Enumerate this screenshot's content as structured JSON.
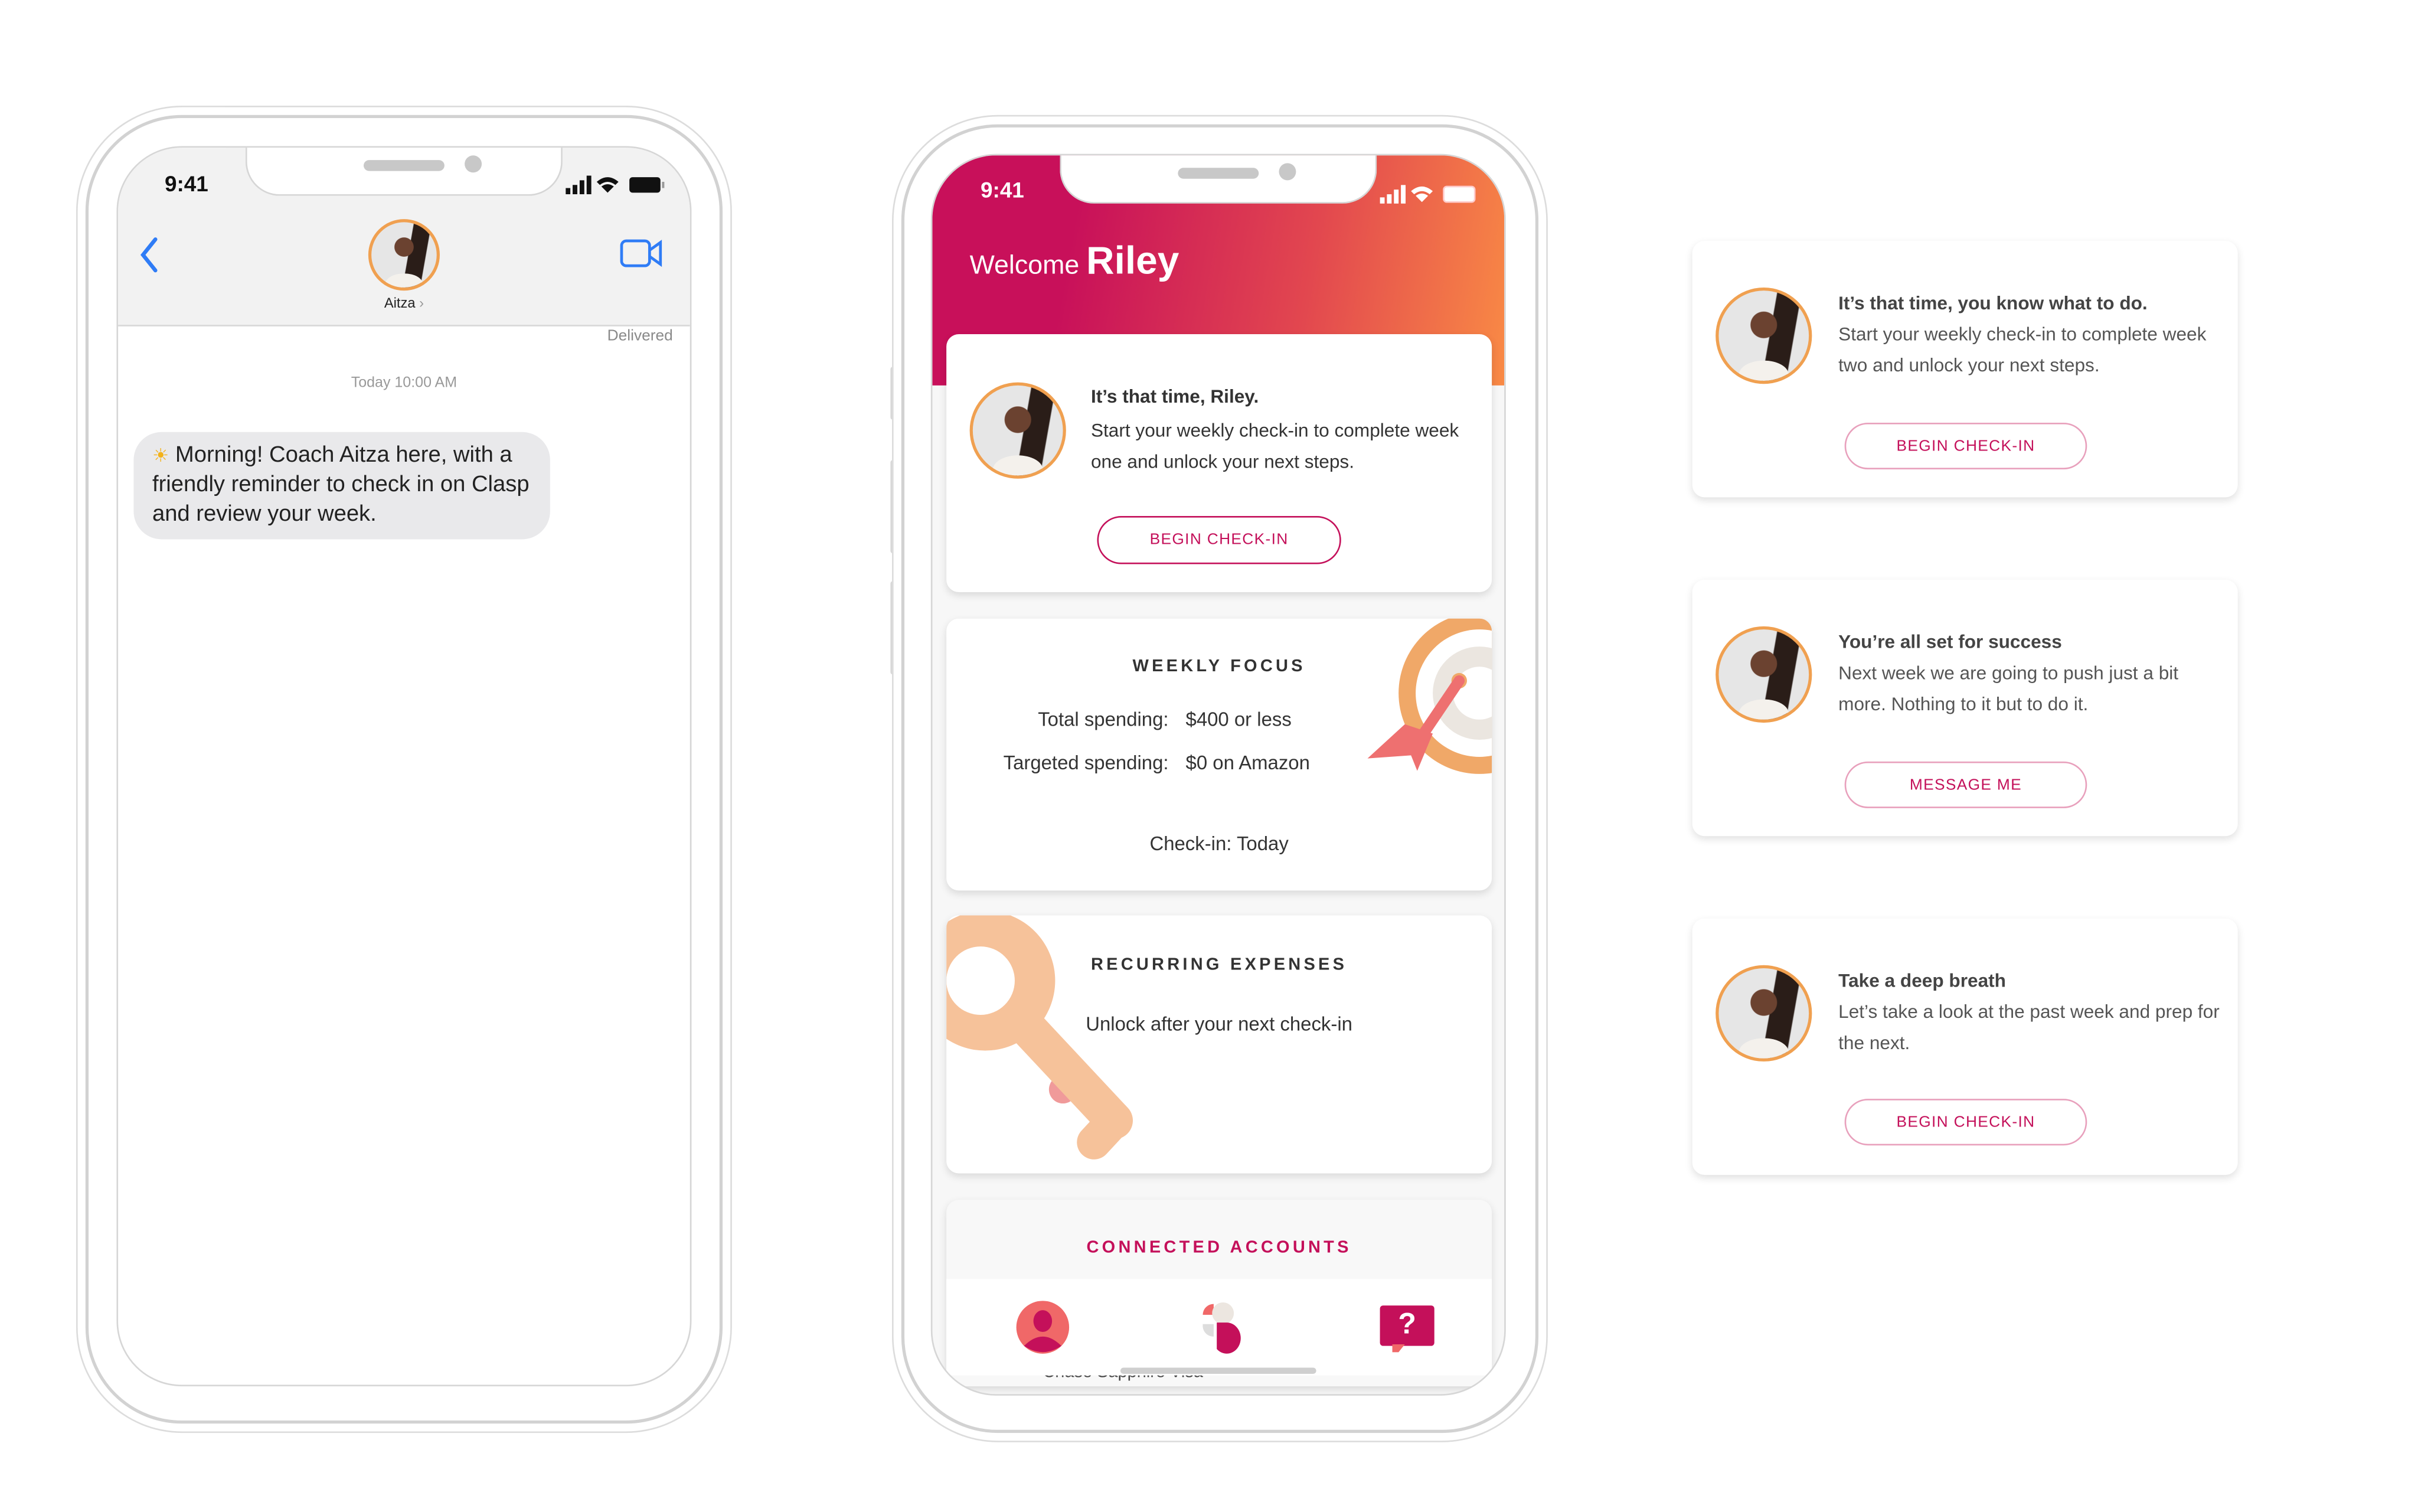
{
  "messages_phone": {
    "status_time": "9:41",
    "contact_name": "Aitza",
    "contact_chevron": "›",
    "delivered": "Delivered",
    "timestamp": "Today 10:00 AM",
    "message_emoji": "☀",
    "message_text": "Morning! Coach Aitza here, with a friendly reminder to check in on Clasp and review your week.",
    "icons": {
      "back": "chevron-left-icon",
      "video": "video-camera-icon"
    },
    "accent": "#2f7cf6"
  },
  "app_phone": {
    "status_time": "9:41",
    "welcome": "Welcome",
    "user_name": "Riley",
    "checkin_card": {
      "title": "It’s that time, Riley.",
      "body": "Start your weekly check-in to complete week one and unlock your next steps.",
      "button": "BEGIN CHECK-IN"
    },
    "weekly_focus": {
      "heading": "WEEKLY FOCUS",
      "rows": [
        {
          "label": "Total spending:",
          "value": "$400 or less"
        },
        {
          "label": "Targeted spending:",
          "value": "$0 on Amazon"
        }
      ],
      "checkin": "Check-in: Today"
    },
    "recurring": {
      "heading": "RECURRING EXPENSES",
      "body": "Unlock after your next check-in"
    },
    "connected": {
      "heading": "CONNECTED ACCOUNTS",
      "peek_text": "Chase Sapphire Visa"
    },
    "nav": [
      {
        "icon": "profile-icon"
      },
      {
        "icon": "clasp-logo-icon"
      },
      {
        "icon": "help-chat-icon",
        "glyph": "?"
      }
    ],
    "colors": {
      "gradient_start": "#c8105a",
      "gradient_end": "#f98a45",
      "accent": "#c4105a"
    }
  },
  "variant_cards": [
    {
      "title": "It’s that time, you know what to do.",
      "body": "Start your weekly check-in to complete week two and unlock your next steps.",
      "button": "BEGIN CHECK-IN"
    },
    {
      "title": "You’re all set for success",
      "body": "Next week we are going to push just a bit more. Nothing to it but to do it.",
      "button": "MESSAGE ME"
    },
    {
      "title": "Take a deep breath",
      "body": "Let’s take a look at the past week and prep for the next.",
      "button": "BEGIN CHECK-IN"
    }
  ]
}
